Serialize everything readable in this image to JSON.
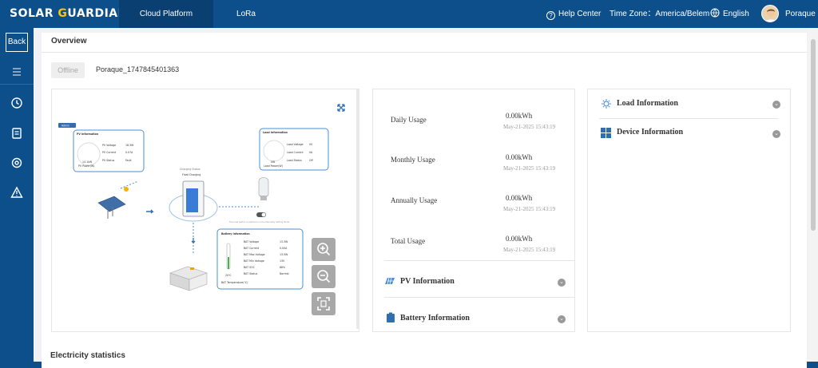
{
  "brand": {
    "part1": "SOLAR ",
    "part2": "G",
    "part3": "UARDIAN"
  },
  "nav": {
    "tabs": [
      {
        "label": "Cloud Platform",
        "active": true
      },
      {
        "label": "LoRa",
        "active": false
      }
    ]
  },
  "header": {
    "help": "Help Center",
    "timezone": "Time Zone：America/Belem",
    "language": "English",
    "user": "Poraque"
  },
  "sidebar": {
    "back": "Back"
  },
  "overview": {
    "title": "Overview",
    "status": "Offline",
    "device_name": "Poraque_1747845401363"
  },
  "diagram": {
    "badge": "Admin",
    "charging_status": "Charging Status",
    "charging_mode": "Float Charging",
    "pv": {
      "title": "PV Information",
      "rows": [
        {
          "label": "PV Voltage",
          "value": "18.3W"
        },
        {
          "label": "PV Current",
          "value": "0.07A"
        },
        {
          "label": "PV Status",
          "value": "Fault"
        }
      ],
      "power_value": "14.1kW",
      "power_label": "PV Power(W)"
    },
    "load": {
      "title": "Load Information",
      "rows": [
        {
          "label": "Load Voltage",
          "value": "0V"
        },
        {
          "label": "Load Current",
          "value": "0A"
        },
        {
          "label": "Load Status",
          "value": "Off"
        }
      ],
      "power_value": "0W",
      "power_label": "Load Power(W)"
    },
    "battery": {
      "title": "Battery Information",
      "rows": [
        {
          "label": "BAT Voltage",
          "value": "13.3W"
        },
        {
          "label": "BAT Current",
          "value": "0.00A"
        },
        {
          "label": "BAT Max Voltage",
          "value": "13.5W"
        },
        {
          "label": "BAT Min Voltage",
          "value": "13V"
        },
        {
          "label": "BAT SOC",
          "value": "88%"
        },
        {
          "label": "BAT Status",
          "value": "Normal"
        }
      ],
      "temp_value": "20℃",
      "temp_label": "BAT Temperature(℃)"
    },
    "switch_note": "The load switch is switched on the Manually Setting Mode"
  },
  "usage": {
    "rows": [
      {
        "label": "Daily Usage",
        "value": "0.00kWh",
        "time": "May-21-2025 15:43:19"
      },
      {
        "label": "Monthly Usage",
        "value": "0.00kWh",
        "time": "May-21-2025 15:43:19"
      },
      {
        "label": "Annually Usage",
        "value": "0.00kWh",
        "time": "May-21-2025 15:43:19"
      },
      {
        "label": "Total Usage",
        "value": "0.00kWh",
        "time": "May-21-2025 15:43:19"
      }
    ],
    "pv_info": "PV Information",
    "battery_info": "Battery Information"
  },
  "info": {
    "load_info": "Load Information",
    "device_info": "Device Information"
  },
  "stats": {
    "title": "Electricity statistics"
  },
  "colors": {
    "primary": "#0d4f8b",
    "accent": "#2f6fb0",
    "card_blue": "#4a90d9",
    "yellow": "#ffc400"
  }
}
